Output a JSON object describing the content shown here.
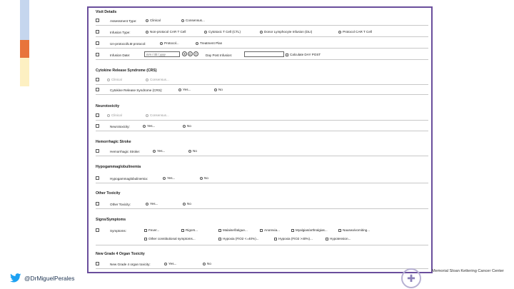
{
  "sections": {
    "visit": "Visit Details",
    "crs": "Cytokine Release Syndrome (CRS)",
    "neuro": "Neurotoxicity",
    "hemo": "Hemorrhagic Stroke",
    "hypo": "Hypogammaglobulinemia",
    "other": "Other Toxicity",
    "signs": "Signs/Symptoms",
    "grade4": "New Grade 4 Organ Toxicity"
  },
  "visit": {
    "assessment_label": "Assessment Type:",
    "assessment_opt1": "Clinical",
    "assessment_opt2": "Consensus...",
    "infusion_type_label": "Infusion Type:",
    "infusion_opt1": "Non-protocol CAR T Cell",
    "infusion_opt2": "Cytotoxic T Cell (CTL)",
    "infusion_opt3": "Donor Lymphocyte Infusion (DLI)",
    "infusion_opt4": "Protocol CAR T Cell",
    "unprotocol_label": "Un-protocol/LM protocol:",
    "unprotocol_opt1": "Protocol...",
    "unprotocol_opt2": "Treatment Plan",
    "date_label": "Infusion Date:",
    "date_placeholder": "mm / dd / yyyy",
    "btn1": "✕",
    "btn2": "C",
    "btn3": "T",
    "day_post_label": "Day Post Infusion:",
    "calc_label": "Calculate DAY POST"
  },
  "crs": {
    "opt1": "Clinical",
    "opt2": "Consensus...",
    "label": "Cytokine Release Syndrome (CRS):",
    "yes": "Yes...",
    "no": "No"
  },
  "neuro": {
    "opt1": "Clinical",
    "opt2": "Consensus...",
    "label": "Neurotoxicity:",
    "yes": "Yes...",
    "no": "No"
  },
  "hemo": {
    "label": "Hemorrhagic Stroke:",
    "yes": "Yes...",
    "no": "No"
  },
  "hypo": {
    "label": "Hypogammaglobulinemia:",
    "yes": "Yes...",
    "no": "No"
  },
  "other": {
    "label": "Other Toxicity:",
    "yes": "Yes...",
    "no": "No"
  },
  "signs": {
    "label": "Symptoms:",
    "items": [
      "Fever...",
      "Rigors...",
      "Malaise/fatigue...",
      "Anorexia...",
      "Myalgias/arthralgias...",
      "Nausea/vomiting...",
      "Other constitutional symptoms...",
      "Hypoxia (FiO2 <=40%)...",
      "Hypoxia (FiO2 >40%)...",
      "Hypotension..."
    ]
  },
  "grade4": {
    "label": "New Grade 4 organ toxicity:",
    "yes": "Yes...",
    "no": "No"
  },
  "footer": {
    "twitter_handle": "@DrMiguelPerales",
    "institution": "Memorial Sloan Kettering Cancer Center"
  },
  "colors": {
    "panel_border": "#6a4e9c",
    "accent_blue": "#c5d6ee",
    "accent_orange": "#e8743b",
    "accent_yellow": "#fdf0c2",
    "twitter_blue": "#1da1f2"
  },
  "icons": {
    "twitter": "twitter-bird-icon",
    "logo": "msk-logo-icon"
  }
}
